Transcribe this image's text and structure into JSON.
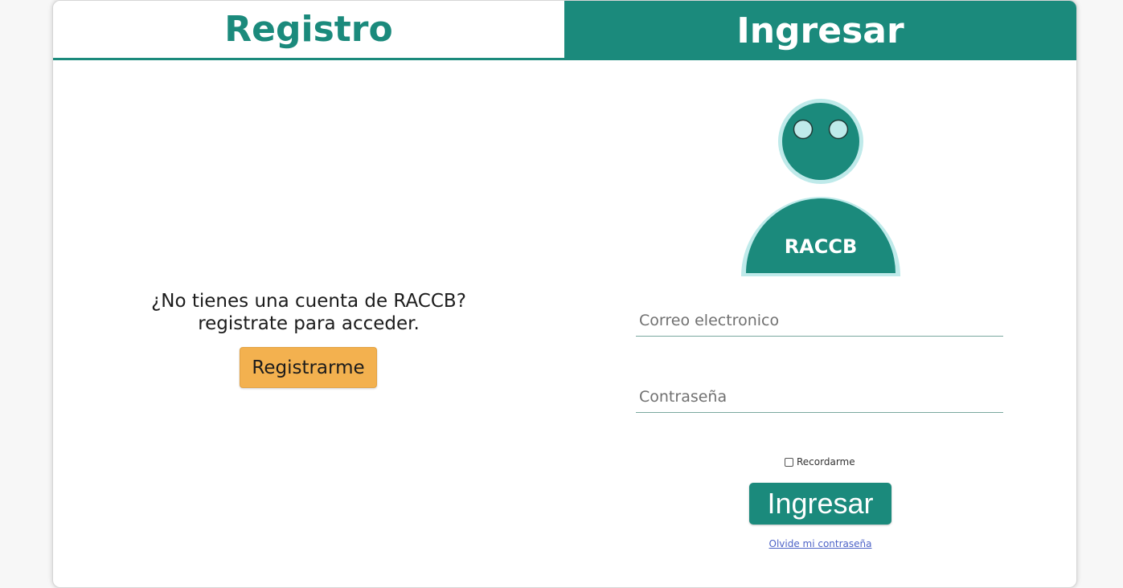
{
  "tabs": {
    "register_label": "Registro",
    "login_label": "Ingresar"
  },
  "register": {
    "prompt_line1": "¿No tienes una cuenta de RACCB?",
    "prompt_line2": "registrate para acceder.",
    "button_label": "Registrarme"
  },
  "login": {
    "avatar_text": "RACCB",
    "email_placeholder": "Correo electronico",
    "email_value": "",
    "password_placeholder": "Contraseña",
    "password_value": "",
    "remember_label": "Recordarme",
    "remember_checked": false,
    "button_label": "Ingresar",
    "forgot_label": "Olvide mi contraseña"
  },
  "colors": {
    "primary": "#1b8a7c",
    "accent": "#f3b14f",
    "avatar_glow": "#bfeaea",
    "link": "#4d63c7"
  },
  "icons": {
    "avatar": "user-avatar-icon"
  }
}
